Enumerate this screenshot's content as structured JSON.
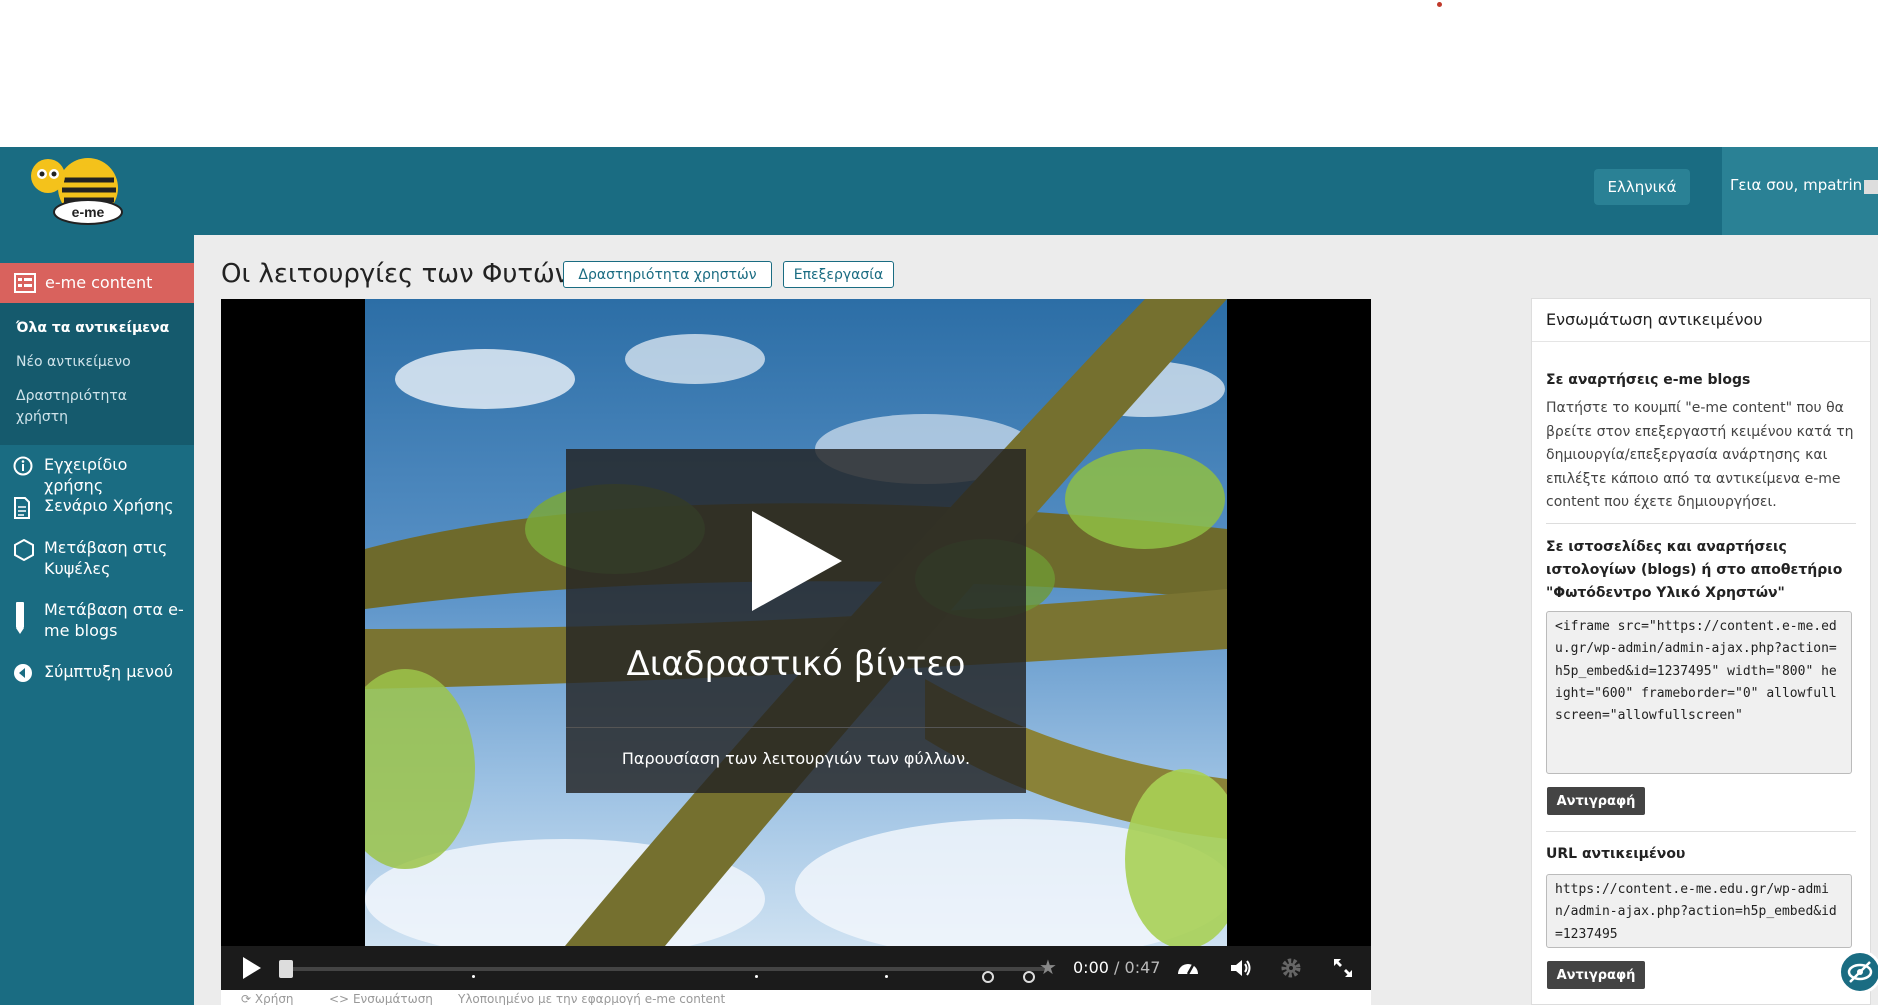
{
  "header": {
    "logo_text": "e-me",
    "language_label": "Ελληνικά",
    "greeting": "Γεια σου, mpatrin"
  },
  "sidebar": {
    "active_item": "e-me content",
    "sub_items": [
      "Όλα τα αντικείμενα",
      "Νέο αντικείμενο",
      "Δραστηριότητα χρήστη"
    ],
    "items": [
      "Εγχειρίδιο χρήσης",
      "Σενάριο Χρήσης",
      "Μετάβαση στις Κυψέλες",
      "Μετάβαση στα e-me blogs",
      "Σύμπτυξη μενού"
    ]
  },
  "page": {
    "title": "Οι λειτουργίες των Φυτών",
    "user_activity_button": "Δραστηριότητα χρηστών",
    "edit_button": "Επεξεργασία"
  },
  "video": {
    "overlay_title": "Διαδραστικό βίντεο",
    "overlay_description": "Παρουσίαση των λειτουργιών των φύλλων.",
    "current_time": "0:00",
    "duration": "/ 0:47",
    "progress": 0
  },
  "meta": {
    "reuse": "Χρήση",
    "embed": "Ενσωμάτωση",
    "credit": "Υλοποιημένο με την εφαρμογή e-me content"
  },
  "embed_panel": {
    "title": "Ενσωμάτωση αντικειμένου",
    "blogs_heading": "Σε αναρτήσεις e-me blogs",
    "blogs_text": "Πατήστε το κουμπί \"e-me content\" που θα βρείτε στον επεξεργαστή κειμένου κατά τη δημιουργία/επεξεργασία ανάρτησης και επιλέξτε κάποιο από τα αντικείμενα e-me content που έχετε δημιουργήσει.",
    "sites_heading": "Σε ιστοσελίδες και αναρτήσεις ιστολογίων (blogs) ή στο αποθετήριο \"Φωτόδεντρο Υλικό Χρηστών\"",
    "iframe_code": "<iframe src=\"https://content.e-me.edu.gr/wp-admin/admin-ajax.php?action=h5p_embed&id=1237495\" width=\"800\" height=\"600\" frameborder=\"0\" allowfullscreen=\"allowfullscreen\"",
    "copy_label": "Αντιγραφή",
    "url_heading": "URL αντικειμένου",
    "url_value": "https://content.e-me.edu.gr/wp-admin/admin-ajax.php?action=h5p_embed&id=1237495",
    "copy_label_2": "Αντιγραφή"
  }
}
